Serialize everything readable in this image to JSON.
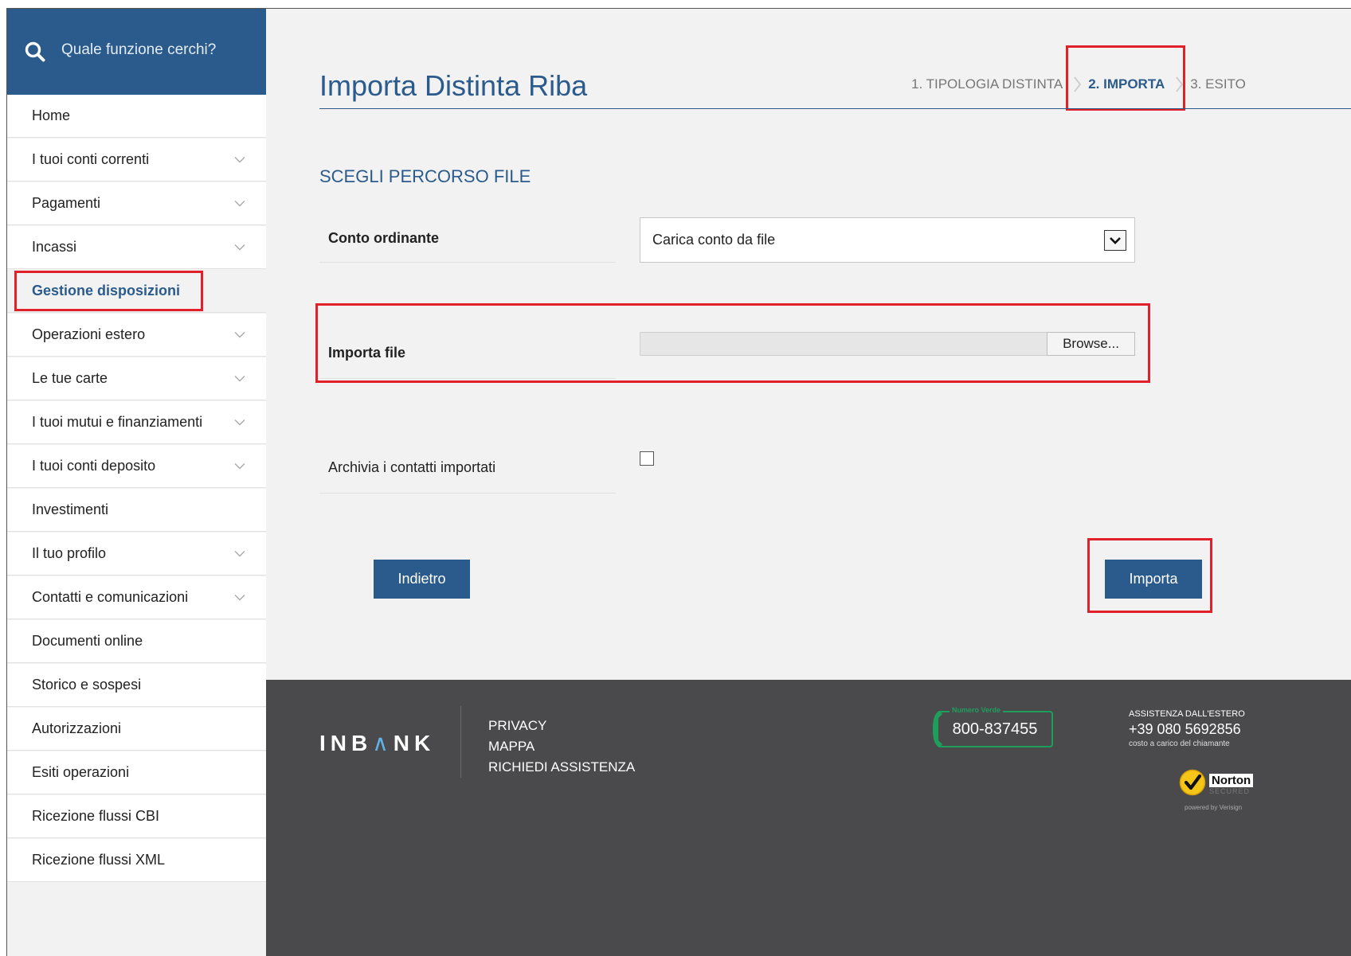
{
  "search": {
    "placeholder": "Quale funzione cerchi?"
  },
  "sidebar": {
    "items": [
      {
        "label": "Home",
        "has_chevron": false
      },
      {
        "label": "I tuoi conti correnti",
        "has_chevron": true
      },
      {
        "label": "Pagamenti",
        "has_chevron": true
      },
      {
        "label": "Incassi",
        "has_chevron": true
      },
      {
        "label": "Gestione disposizioni",
        "has_chevron": false,
        "active": true
      },
      {
        "label": "Operazioni estero",
        "has_chevron": true
      },
      {
        "label": "Le tue carte",
        "has_chevron": true
      },
      {
        "label": "I tuoi mutui e finanziamenti",
        "has_chevron": true
      },
      {
        "label": "I tuoi conti deposito",
        "has_chevron": true
      },
      {
        "label": "Investimenti",
        "has_chevron": false
      },
      {
        "label": "Il tuo profilo",
        "has_chevron": true
      },
      {
        "label": "Contatti e comunicazioni",
        "has_chevron": true
      },
      {
        "label": "Documenti online",
        "has_chevron": false
      },
      {
        "label": "Storico e sospesi",
        "has_chevron": false
      },
      {
        "label": "Autorizzazioni",
        "has_chevron": false
      },
      {
        "label": "Esiti operazioni",
        "has_chevron": false
      },
      {
        "label": "Ricezione flussi CBI",
        "has_chevron": false
      },
      {
        "label": "Ricezione flussi XML",
        "has_chevron": false
      }
    ]
  },
  "main": {
    "title": "Importa Distinta Riba",
    "steps": [
      "1. TIPOLOGIA DISTINTA",
      "2. IMPORTA",
      "3. ESITO"
    ],
    "current_step": 2,
    "section_title": "SCEGLI PERCORSO FILE",
    "conto_label": "Conto ordinante",
    "conto_value": "Carica conto da file",
    "importa_label": "Importa file",
    "browse_label": "Browse...",
    "archivia_label": "Archivia i contatti importati",
    "archivia_checked": false,
    "back_label": "Indietro",
    "submit_label": "Importa"
  },
  "footer": {
    "logo_pre": "INB",
    "logo_post": "NK",
    "links": [
      "PRIVACY",
      "MAPPA",
      "RICHIEDI ASSISTENZA"
    ],
    "phone_tag": "Numero Verde",
    "phone": "800-837455",
    "abroad_title": "ASSISTENZA DALL'ESTERO",
    "abroad_phone": "+39 080 5692856",
    "abroad_note": "costo a carico del chiamante",
    "norton_name": "Norton",
    "norton_secured": "SECURED",
    "norton_powered": "powered by Verisign"
  },
  "colors": {
    "brand_blue": "#2b5b8c",
    "highlight_red": "#e0212a",
    "footer_bg": "#4a4a4c",
    "phone_green": "#1e9e5b"
  },
  "icons": {
    "search": "search-icon",
    "chevron": "chevron-down-icon",
    "step_separator": "chevron-right-icon",
    "phone": "phone-icon",
    "norton": "norton-check-icon"
  }
}
